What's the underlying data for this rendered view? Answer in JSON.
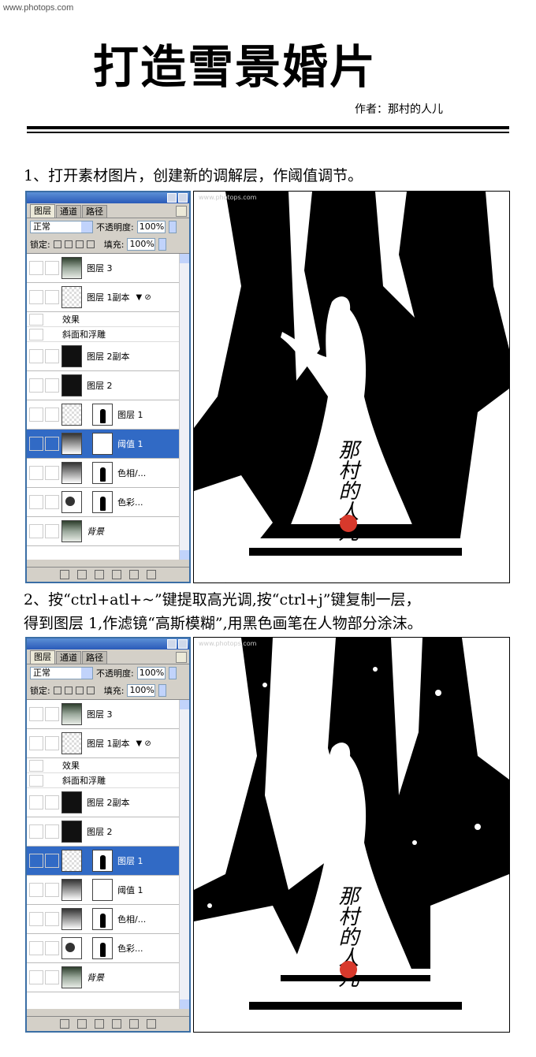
{
  "watermark": "www.photops.com",
  "title": "打造雪景婚片",
  "author": "作者：那村的人儿",
  "steps": [
    {
      "text_lines": [
        "1、打开素材图片，创建新的调解层，作阈值调节。"
      ]
    },
    {
      "text_lines": [
        "2、按“ctrl+atl+~”键提取高光调,按“ctrl+j”键复制一层，",
        "得到图层 1,作滤镜“高斯模糊”,用黑色画笔在人物部分涂沫。"
      ]
    }
  ],
  "panels": [
    {
      "tabs": [
        "图层",
        "通道",
        "路径"
      ],
      "blend_mode": "正常",
      "opacity_label": "不透明度:",
      "opacity_value": "100%",
      "lock_label": "锁定:",
      "fill_label": "填充:",
      "fill_value": "100%",
      "layers": [
        {
          "name": "图层 3",
          "thumb": "photo"
        },
        {
          "name": "图层 1副本",
          "thumb": "trans",
          "fx": "▼ ⊘"
        },
        {
          "name": "图层 2副本",
          "thumb": "dark"
        },
        {
          "name": "图层 2",
          "thumb": "dark"
        },
        {
          "name": "图层 1",
          "thumb": "trans"
        },
        {
          "name": "阈值 1",
          "thumb": "grad",
          "selected": true
        },
        {
          "name": "色相/...",
          "thumb": "grad"
        },
        {
          "name": "色彩...",
          "thumb": "shape"
        },
        {
          "name": "背景",
          "thumb": "photo"
        }
      ],
      "effects": {
        "label": "效果",
        "item": "斜面和浮雕"
      }
    },
    {
      "tabs": [
        "图层",
        "通道",
        "路径"
      ],
      "blend_mode": "正常",
      "opacity_label": "不透明度:",
      "opacity_value": "100%",
      "lock_label": "锁定:",
      "fill_label": "填充:",
      "fill_value": "100%",
      "layers": [
        {
          "name": "图层 3",
          "thumb": "photo"
        },
        {
          "name": "图层 1副本",
          "thumb": "trans",
          "fx": "▼ ⊘"
        },
        {
          "name": "图层 2副本",
          "thumb": "dark"
        },
        {
          "name": "图层 2",
          "thumb": "dark"
        },
        {
          "name": "图层 1",
          "thumb": "trans",
          "selected": true
        },
        {
          "name": "阈值 1",
          "thumb": "grad"
        },
        {
          "name": "色相/...",
          "thumb": "grad"
        },
        {
          "name": "色彩...",
          "thumb": "shape"
        },
        {
          "name": "背景",
          "thumb": "photo"
        }
      ],
      "effects": {
        "label": "效果",
        "item": "斜面和浮雕"
      }
    }
  ],
  "images": [
    {
      "url": "www.photops.com",
      "signature": "那村的人儿"
    },
    {
      "url": "www.photops.com",
      "signature": "那村的人儿"
    }
  ]
}
